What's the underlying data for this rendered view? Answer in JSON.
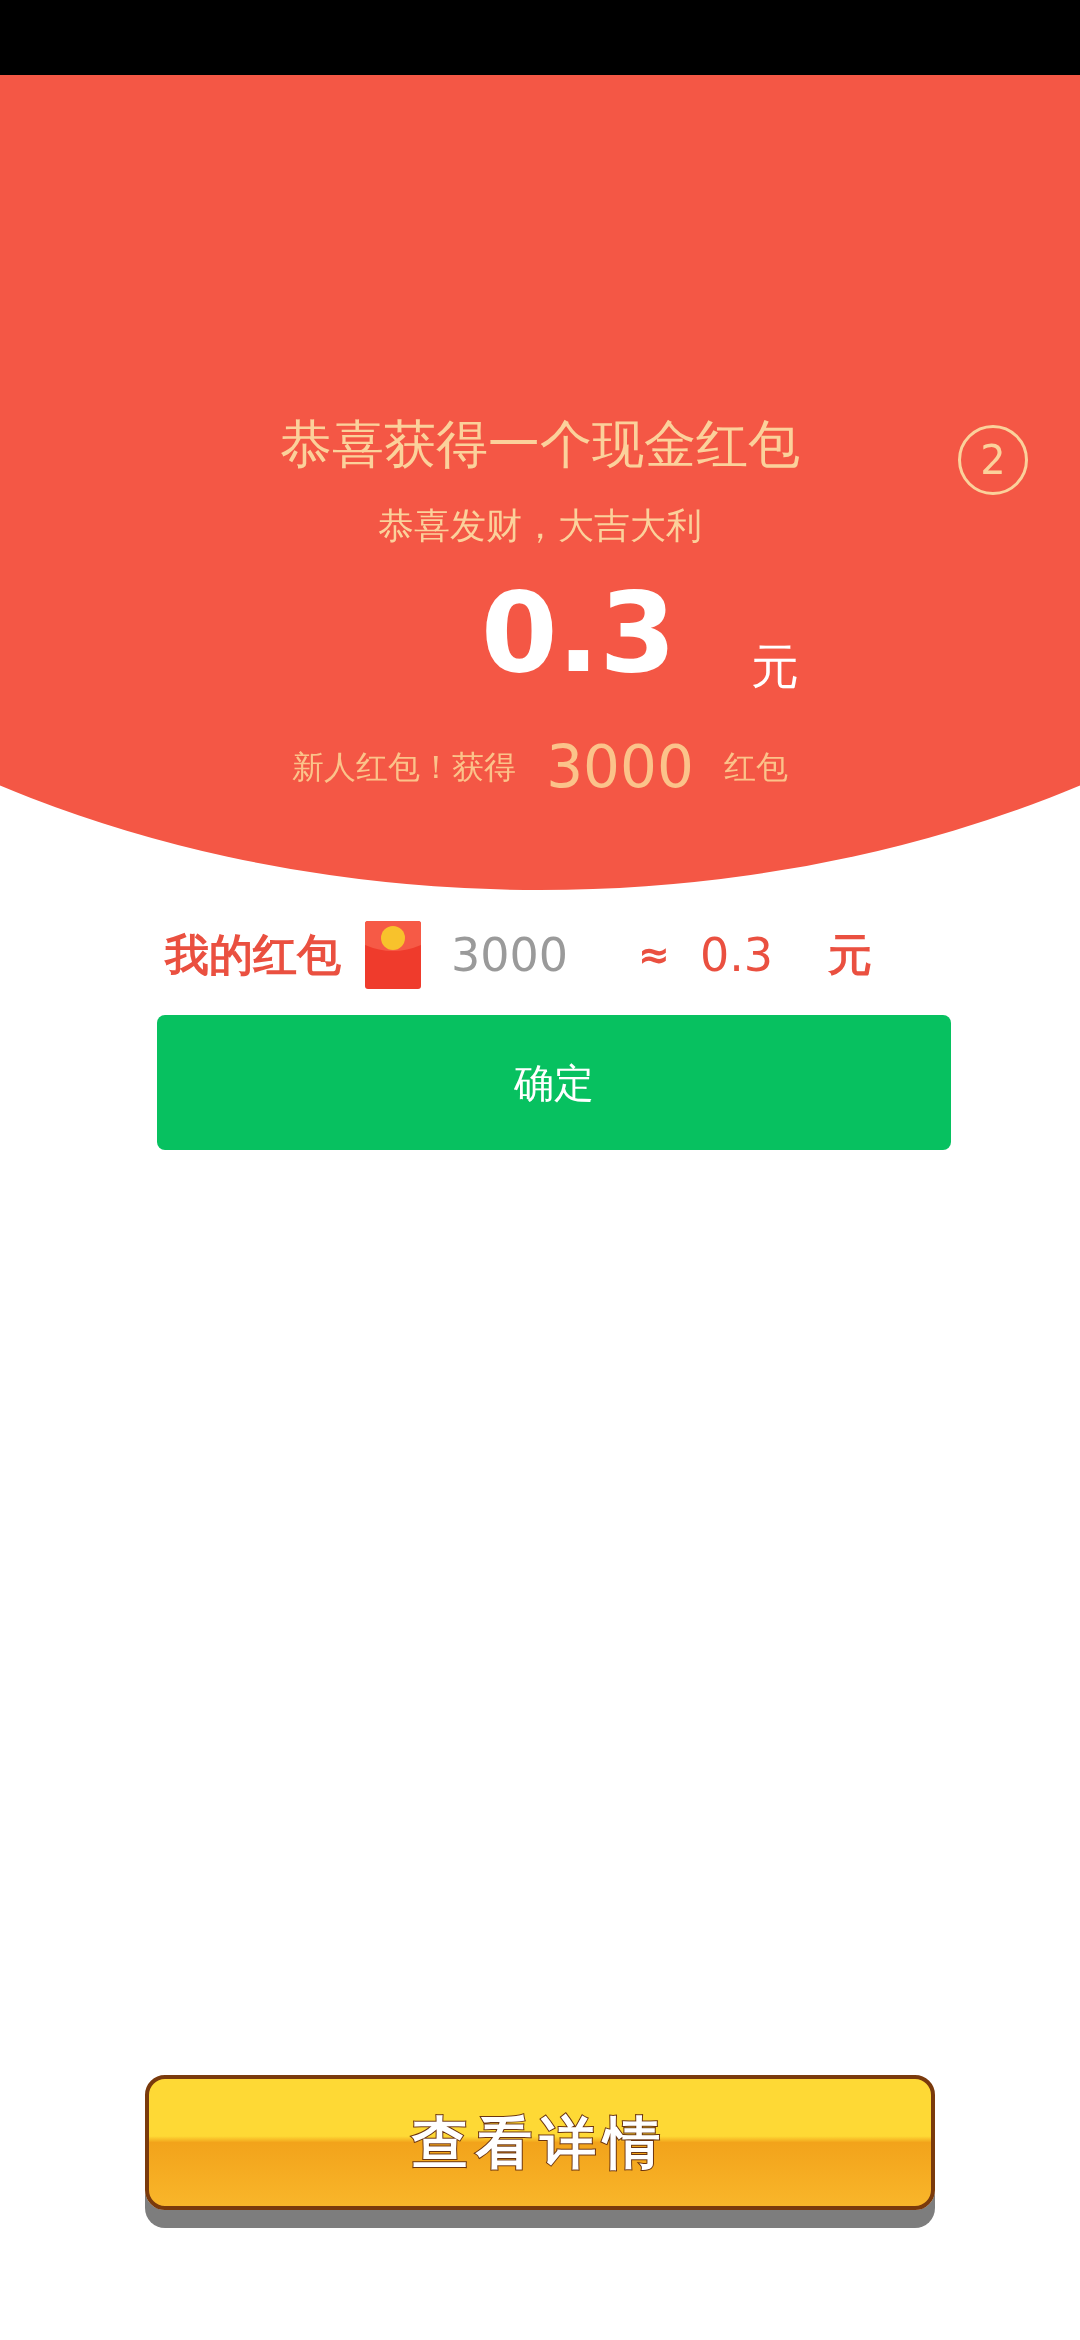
{
  "header": {
    "title": "恭喜获得一个现金红包",
    "countdown": "2",
    "subtitle": "恭喜发财，大吉大利",
    "amount": "0.3",
    "amount_unit": "元",
    "bonus_prefix": "新人红包！获得",
    "bonus_amount": "3000",
    "bonus_suffix": "红包"
  },
  "my_packets": {
    "label": "我的红包",
    "count": "3000",
    "approx": "≈",
    "value": "0.3",
    "unit": "元"
  },
  "confirm_button": "确定",
  "details_button": "查看详情"
}
